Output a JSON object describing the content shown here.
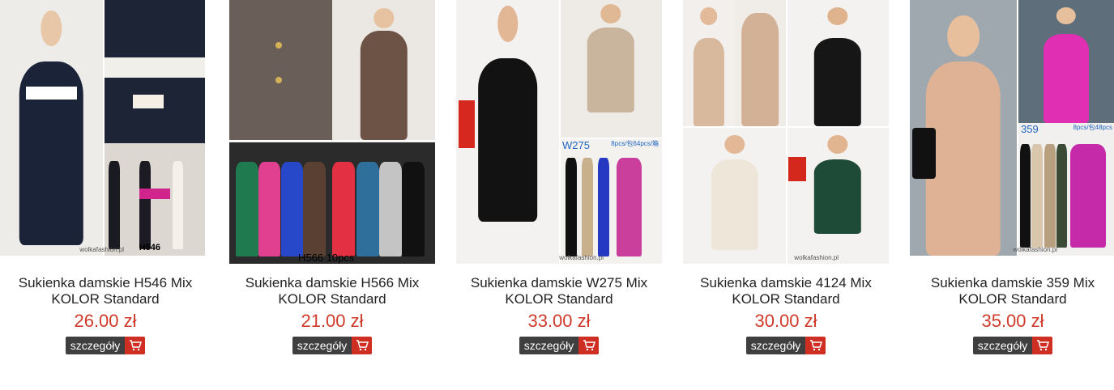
{
  "watermark": "wolkafashion.pl",
  "details_label": "szczegóły",
  "colors": {
    "price": "#d03a2a",
    "details_bg": "#3f3f3f",
    "cart_bg": "#cf2e22"
  },
  "products": [
    {
      "title_line1": "Sukienka damskie H546 Mix",
      "title_line2": "KOLOR Standard",
      "price": "26.00 zł",
      "image_code": "H546",
      "cart_icon": "cart-icon"
    },
    {
      "title_line1": "Sukienka damskie H566 Mix",
      "title_line2": "KOLOR Standard",
      "price": "21.00 zł",
      "image_code": "H566 10pcs",
      "cart_icon": "cart-icon"
    },
    {
      "title_line1": "Sukienka damskie W275 Mix",
      "title_line2": "KOLOR Standard",
      "price": "33.00 zł",
      "image_code": "W275",
      "pack_text": "8pcs/包64pcs/箱",
      "cart_icon": "cart-icon"
    },
    {
      "title_line1": "Sukienka damskie 4124 Mix",
      "title_line2": "KOLOR Standard",
      "price": "30.00 zł",
      "cart_icon": "cart-icon"
    },
    {
      "title_line1": "Sukienka damskie 359 Mix",
      "title_line2": "KOLOR Standard",
      "price": "35.00 zł",
      "image_code": "359",
      "pack_text": "8pcs/包48pcs",
      "cart_icon": "cart-icon"
    }
  ]
}
